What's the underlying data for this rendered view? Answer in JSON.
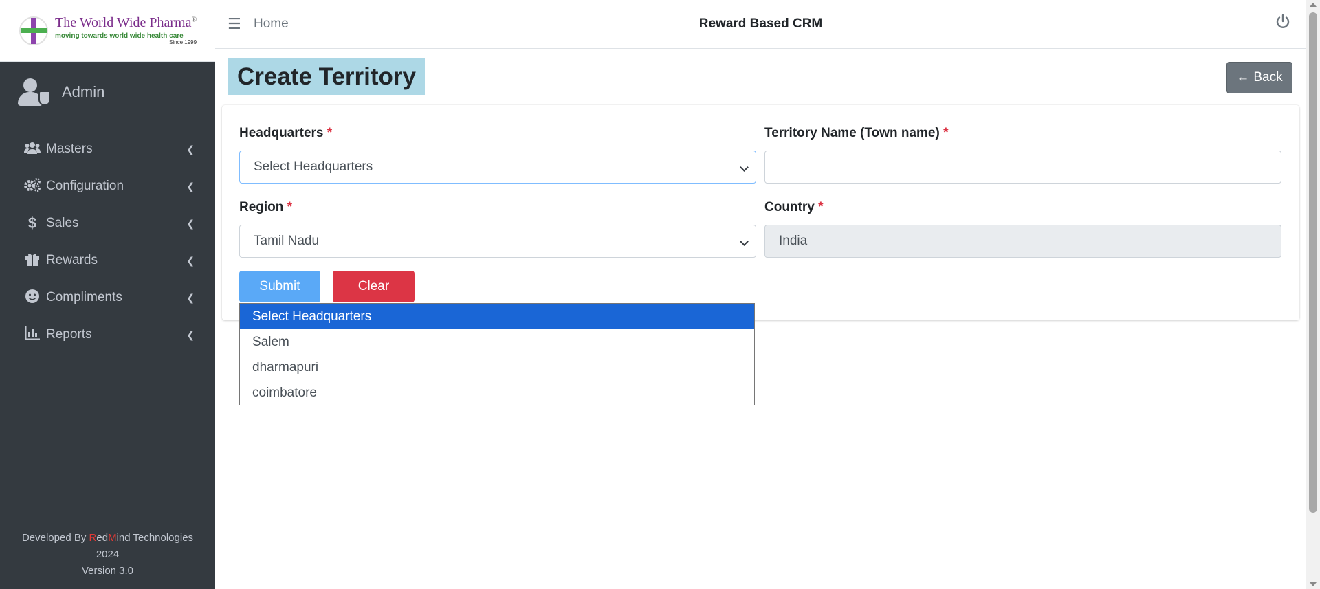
{
  "brand": {
    "name": "The World Wide Pharma",
    "registered": "®",
    "tagline": "moving towards world wide health care",
    "since": "Since 1999"
  },
  "user": {
    "name": "Admin"
  },
  "sidebar": {
    "items": [
      {
        "label": "Masters",
        "icon": "users-icon"
      },
      {
        "label": "Configuration",
        "icon": "gears-icon"
      },
      {
        "label": "Sales",
        "icon": "dollar-icon"
      },
      {
        "label": "Rewards",
        "icon": "gift-icon"
      },
      {
        "label": "Compliments",
        "icon": "smile-icon"
      },
      {
        "label": "Reports",
        "icon": "bar-chart-icon"
      }
    ],
    "footer": {
      "developed_by": "Developed By",
      "company_r": "R",
      "company_ed": "ed",
      "company_m": "M",
      "company_rest": "ind Technologies",
      "year": "2024",
      "version": "Version 3.0"
    }
  },
  "header": {
    "home_label": "Home",
    "title": "Reward Based CRM"
  },
  "page": {
    "title": "Create Territory",
    "back_label": "Back"
  },
  "form": {
    "headquarters": {
      "label": "Headquarters",
      "required": "*",
      "value": "Select Headquarters"
    },
    "territory": {
      "label": "Territory Name (Town name)",
      "required": "*",
      "value": ""
    },
    "region": {
      "label": "Region",
      "required": "*",
      "value": "Tamil Nadu"
    },
    "country": {
      "label": "Country",
      "required": "*",
      "value": "India"
    },
    "submit_label": "Submit",
    "clear_label": "Clear"
  },
  "dropdown": {
    "options": [
      "Select Headquarters",
      "Salem",
      "dharmapuri",
      "coimbatore"
    ]
  },
  "colors": {
    "sidebar_bg": "#343a40",
    "title_highlight": "#add8e6",
    "submit": "#5aa9f7",
    "clear": "#dc3545",
    "option_selected": "#1a66d6"
  }
}
